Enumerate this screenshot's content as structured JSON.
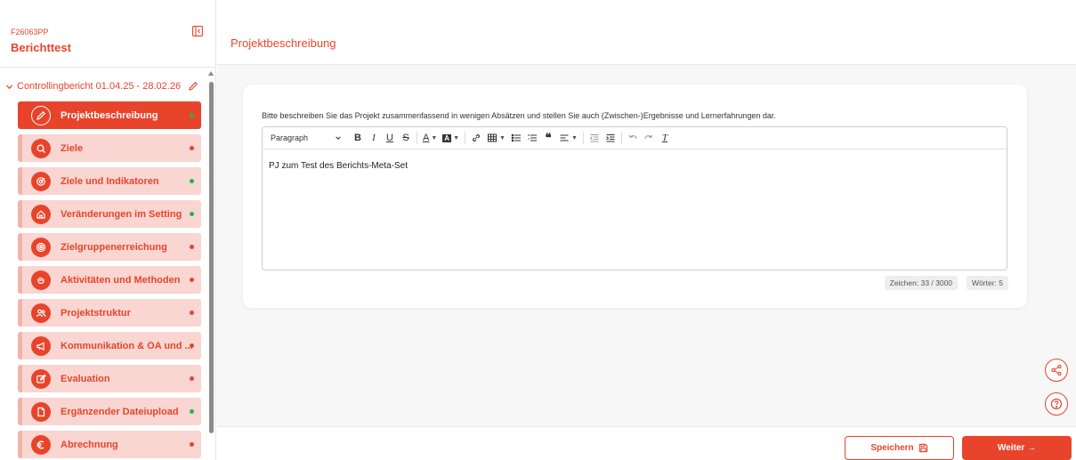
{
  "colors": {
    "accent": "#e8442b",
    "status_green": "#2bb24c",
    "status_red": "#e8442b",
    "nav_bg": "#f9d6d1"
  },
  "sidebar": {
    "project_code": "F26063PP",
    "project_title": "Berichttest",
    "report_label": "Controllingbericht 01.04.25 - 28.02.26",
    "items": [
      {
        "label": "Projektbeschreibung",
        "icon": "pencil-icon",
        "status": "green",
        "active": true
      },
      {
        "label": "Ziele",
        "icon": "search-icon",
        "status": "red",
        "active": false
      },
      {
        "label": "Ziele und Indikatoren",
        "icon": "target-arrow-icon",
        "status": "green",
        "active": false
      },
      {
        "label": "Veränderungen im Setting",
        "icon": "home-icon",
        "status": "green",
        "active": false
      },
      {
        "label": "Zielgruppenerreichung",
        "icon": "target-icon",
        "status": "red",
        "active": false
      },
      {
        "label": "Aktivitäten und Methoden",
        "icon": "hand-icon",
        "status": "red",
        "active": false
      },
      {
        "label": "Projektstruktur",
        "icon": "people-icon",
        "status": "red",
        "active": false
      },
      {
        "label": "Kommunikation & ÖA und ...",
        "icon": "megaphone-icon",
        "status": "red",
        "active": false
      },
      {
        "label": "Evaluation",
        "icon": "edit-square-icon",
        "status": "red",
        "active": false
      },
      {
        "label": "Ergänzender Dateiupload",
        "icon": "file-icon",
        "status": "green",
        "active": false
      },
      {
        "label": "Abrechnung",
        "icon": "euro-icon",
        "status": "red",
        "active": false
      }
    ]
  },
  "main": {
    "page_title": "Projektbeschreibung",
    "description": "Bitte beschreiben Sie das Projekt zusammenfassend in wenigen Absätzen und stellen Sie auch (Zwischen-)Ergebnisse und Lernerfahrungen dar.",
    "editor": {
      "format_select": "Paragraph",
      "content": "PJ zum Test des Berichts-Meta-Set"
    },
    "char_count": "Zeichen: 33 / 3000",
    "word_count": "Wörter: 5"
  },
  "footer": {
    "save_label": "Speichern",
    "next_label": "Weiter →"
  }
}
